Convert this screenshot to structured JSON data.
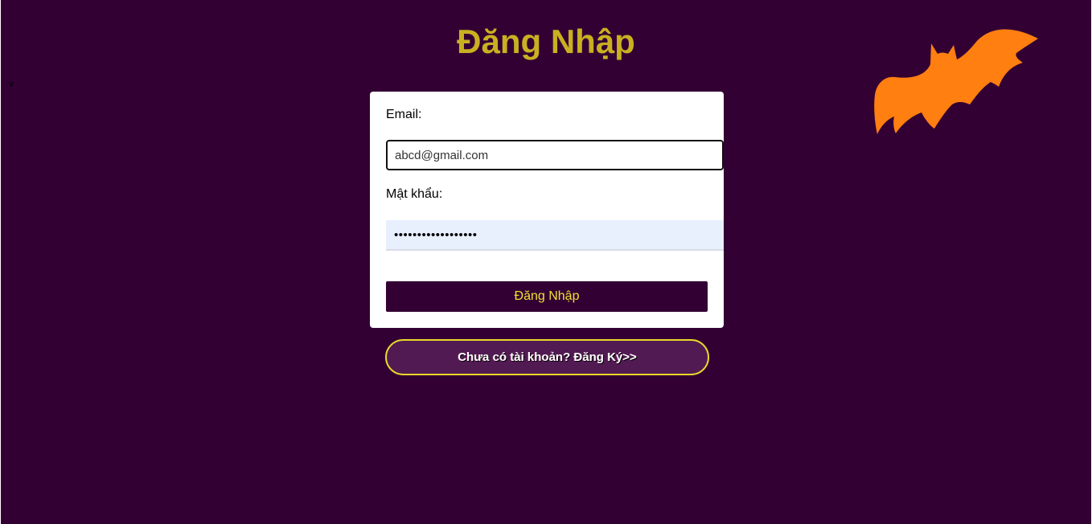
{
  "page": {
    "title": "Đăng Nhập",
    "stray_char": "v"
  },
  "form": {
    "email_label": "Email:",
    "email_value": "abcd@gmail.com",
    "password_label": "Mật khẩu:",
    "password_value": "••••••••••••••••••",
    "submit_label": "Đăng Nhập"
  },
  "register": {
    "label": "Chưa có tài khoản? Đăng Ký>>"
  },
  "decor": {
    "icon": "bat-icon"
  },
  "colors": {
    "background": "#330033",
    "title": "#c9b021",
    "bat": "#ff7f11",
    "button_text": "#f2e130",
    "register_border": "#e9d82b"
  }
}
